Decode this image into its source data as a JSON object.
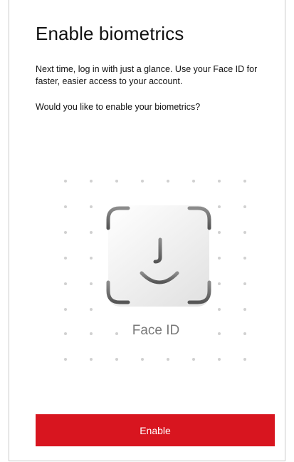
{
  "page": {
    "title": "Enable biometrics",
    "description": "Next time, log in with just a glance. Use your Face ID for faster, easier access to your account.",
    "question": "Would you like to enable your biometrics?"
  },
  "illustration": {
    "icon": "face-id-icon",
    "label": "Face ID"
  },
  "actions": {
    "enable_label": "Enable"
  },
  "colors": {
    "accent": "#d8151f",
    "text": "#111111",
    "dots": "#d0d0d0"
  }
}
